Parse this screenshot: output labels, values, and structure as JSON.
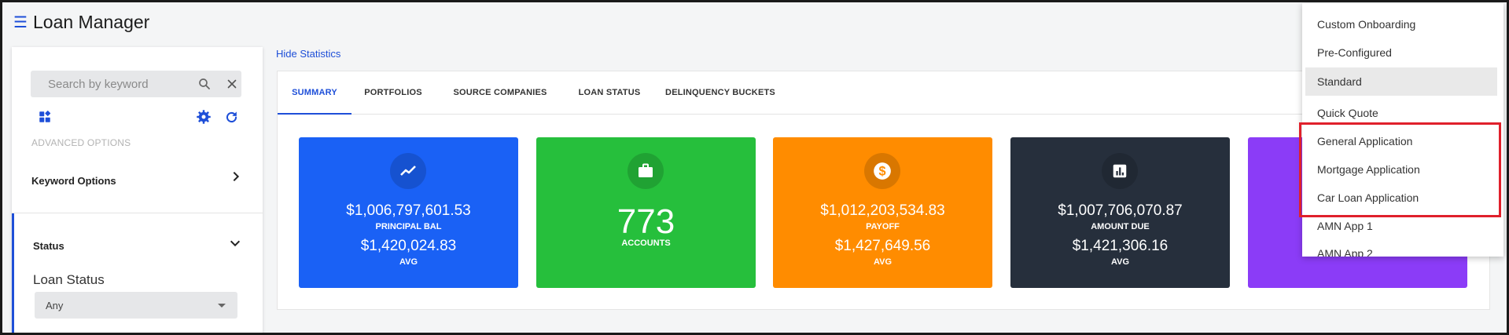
{
  "header": {
    "menu_icon": "hamburger-icon",
    "title": "Loan Manager"
  },
  "sidebar": {
    "search_placeholder": "Search by keyword",
    "icons": [
      "search-icon",
      "close-icon",
      "widgets-icon",
      "gear-icon",
      "refresh-icon"
    ],
    "advanced_options": "ADVANCED OPTIONS",
    "keyword_options": "Keyword Options",
    "status_section": "Status",
    "loan_status_label": "Loan Status",
    "loan_status_value": "Any"
  },
  "main": {
    "hide_statistics": "Hide Statistics",
    "tabs": [
      {
        "label": "SUMMARY",
        "active": true
      },
      {
        "label": "PORTFOLIOS",
        "active": false
      },
      {
        "label": "SOURCE COMPANIES",
        "active": false
      },
      {
        "label": "LOAN STATUS",
        "active": false
      },
      {
        "label": "DELINQUENCY BUCKETS",
        "active": false
      }
    ],
    "cards": [
      {
        "icon": "trending-up-icon",
        "color": "#1a61f5",
        "value": "$1,006,797,601.53",
        "label": "PRINCIPAL BAL",
        "avg_value": "$1,420,024.83",
        "avg_label": "AVG"
      },
      {
        "icon": "briefcase-icon",
        "color": "#26bf3c",
        "value": "773",
        "label": "ACCOUNTS"
      },
      {
        "icon": "dollar-icon",
        "color": "#ff8c00",
        "value": "$1,012,203,534.83",
        "label": "PAYOFF",
        "avg_value": "$1,427,649.56",
        "avg_label": "AVG"
      },
      {
        "icon": "bar-chart-icon",
        "color": "#262f3c",
        "value": "$1,007,706,070.87",
        "label": "AMOUNT DUE",
        "avg_value": "$1,421,306.16",
        "avg_label": "AVG"
      },
      {
        "icon": "",
        "color": "#8b3cf7"
      }
    ]
  },
  "dropdown": {
    "items": [
      {
        "label": "Custom Onboarding"
      },
      {
        "label": "Pre-Configured"
      },
      {
        "label": "Standard",
        "selected": true
      },
      {
        "label": "Quick Quote"
      },
      {
        "label": "General Application"
      },
      {
        "label": "Mortgage Application"
      },
      {
        "label": "Car Loan Application"
      },
      {
        "label": "AMN App 1"
      },
      {
        "label": "AMN App 2"
      }
    ],
    "highlight_color": "#e0202b"
  }
}
